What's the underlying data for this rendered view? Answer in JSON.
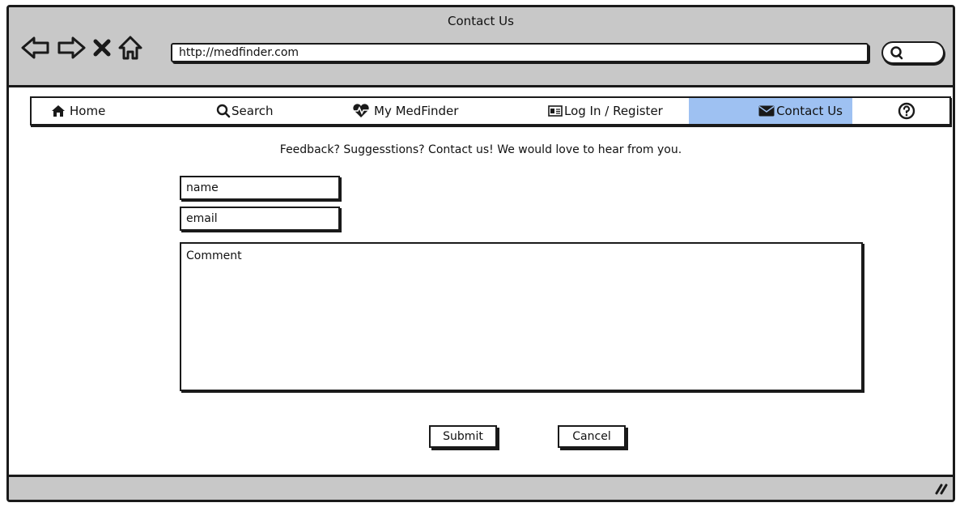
{
  "window": {
    "title": "Contact Us"
  },
  "browser": {
    "url": "http://medfinder.com",
    "icons": [
      "back-arrow-icon",
      "forward-arrow-icon",
      "close-x-icon",
      "home-outline-icon",
      "search-icon"
    ]
  },
  "menu": {
    "items": [
      {
        "label": "Home",
        "icon": "home-icon"
      },
      {
        "label": "Search",
        "icon": "search-icon"
      },
      {
        "label": "My MedFinder",
        "icon": "heartbeat-icon"
      },
      {
        "label": "Log In / Register",
        "icon": "id-card-icon"
      },
      {
        "label": "Contact Us",
        "icon": "envelope-icon",
        "active": true
      },
      {
        "label": "",
        "icon": "help-icon"
      }
    ],
    "active_color": "#9ec1f2"
  },
  "form": {
    "intro": "Feedback? Suggesstions? Contact us! We would love to hear from you.",
    "name_value": "name",
    "email_value": "email",
    "comment_value": "Comment",
    "submit_label": "Submit",
    "cancel_label": "Cancel"
  },
  "statusbar": {
    "icon": "resize-grip-icon"
  }
}
